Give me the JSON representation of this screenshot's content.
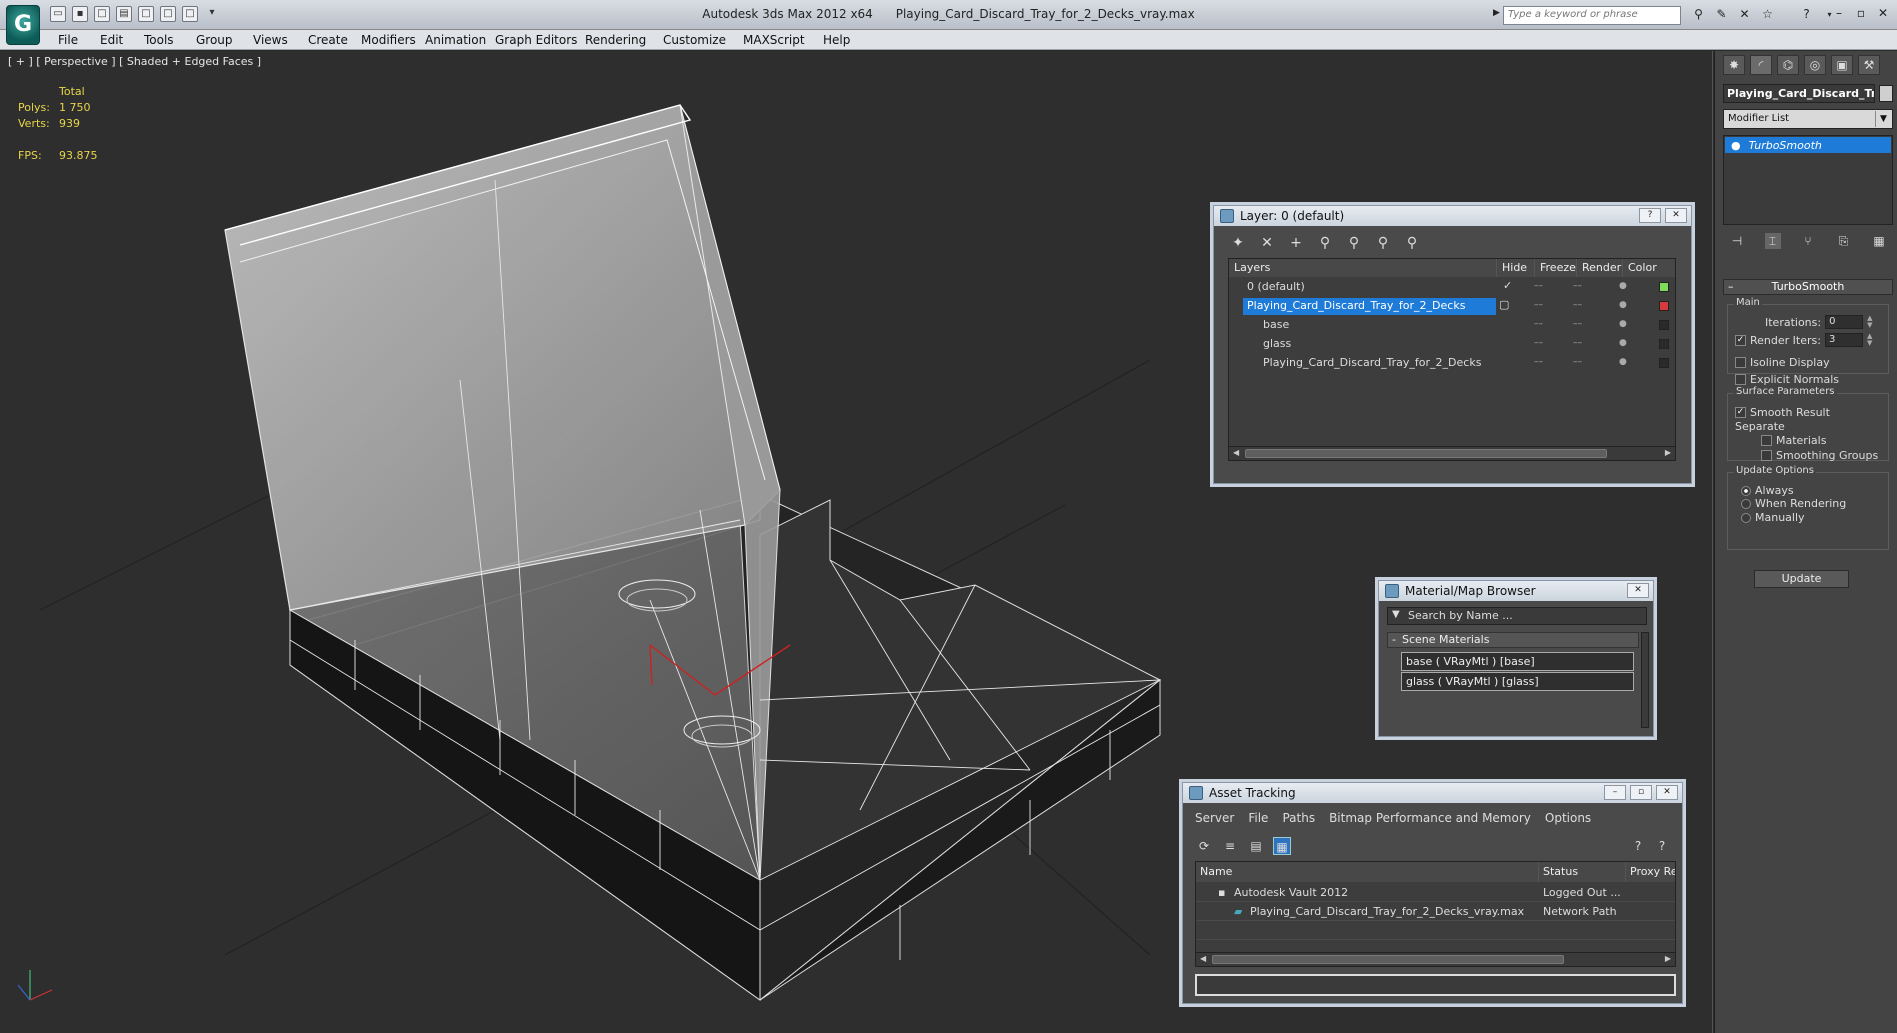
{
  "titlebar": {
    "app_title": "Autodesk 3ds Max  2012 x64",
    "file_title": "Playing_Card_Discard_Tray_for_2_Decks_vray.max",
    "search_placeholder": "Type a keyword or phrase"
  },
  "menu": [
    "File",
    "Edit",
    "Tools",
    "Group",
    "Views",
    "Create",
    "Modifiers",
    "Animation",
    "Graph Editors",
    "Rendering",
    "Customize",
    "MAXScript",
    "Help"
  ],
  "viewport": {
    "label": "[ + ] [ Perspective ] [ Shaded + Edged Faces ]",
    "stats": {
      "total_label": "Total",
      "polys_label": "Polys:",
      "polys_value": "1 750",
      "verts_label": "Verts:",
      "verts_value": "939",
      "fps_label": "FPS:",
      "fps_value": "93.875"
    }
  },
  "command_panel": {
    "object_name": "Playing_Card_Discard_Tr",
    "modifier_list": "Modifier List",
    "stack_item": "TurboSmooth",
    "rollout_title": "TurboSmooth",
    "main_group": "Main",
    "iterations_label": "Iterations:",
    "iterations_value": "0",
    "render_iters_label": "Render Iters:",
    "render_iters_value": "3",
    "isoline_label": "Isoline Display",
    "explicit_normals_label": "Explicit Normals",
    "surface_group": "Surface Parameters",
    "smooth_result_label": "Smooth Result",
    "separate_label": "Separate",
    "materials_label": "Materials",
    "smoothing_groups_label": "Smoothing Groups",
    "update_group": "Update Options",
    "always_label": "Always",
    "when_rendering_label": "When Rendering",
    "manually_label": "Manually",
    "update_button": "Update"
  },
  "layer_dialog": {
    "title": "Layer: 0 (default)",
    "columns": [
      "Layers",
      "Hide",
      "Freeze",
      "Render",
      "Color"
    ],
    "rows": [
      {
        "name": "0 (default)",
        "color": "#7ddc5a"
      },
      {
        "name": "Playing_Card_Discard_Tray_for_2_Decks",
        "color": "#d83a3a"
      },
      {
        "name": "base",
        "color": "#2a2a2a"
      },
      {
        "name": "glass",
        "color": "#2a2a2a"
      },
      {
        "name": "Playing_Card_Discard_Tray_for_2_Decks",
        "color": "#2a2a2a"
      }
    ]
  },
  "material_browser": {
    "title": "Material/Map Browser",
    "search_placeholder": "Search by Name ...",
    "group": "Scene Materials",
    "items": [
      "base  ( VRayMtl ) [base]",
      "glass  ( VRayMtl ) [glass]"
    ]
  },
  "asset_tracking": {
    "title": "Asset Tracking",
    "menu": [
      "Server",
      "File",
      "Paths",
      "Bitmap Performance and Memory",
      "Options"
    ],
    "columns": [
      "Name",
      "Status",
      "Proxy Re"
    ],
    "rows": [
      {
        "name": "Autodesk Vault 2012",
        "status": "Logged Out ..."
      },
      {
        "name": "Playing_Card_Discard_Tray_for_2_Decks_vray.max",
        "status": "Network Path"
      }
    ]
  }
}
